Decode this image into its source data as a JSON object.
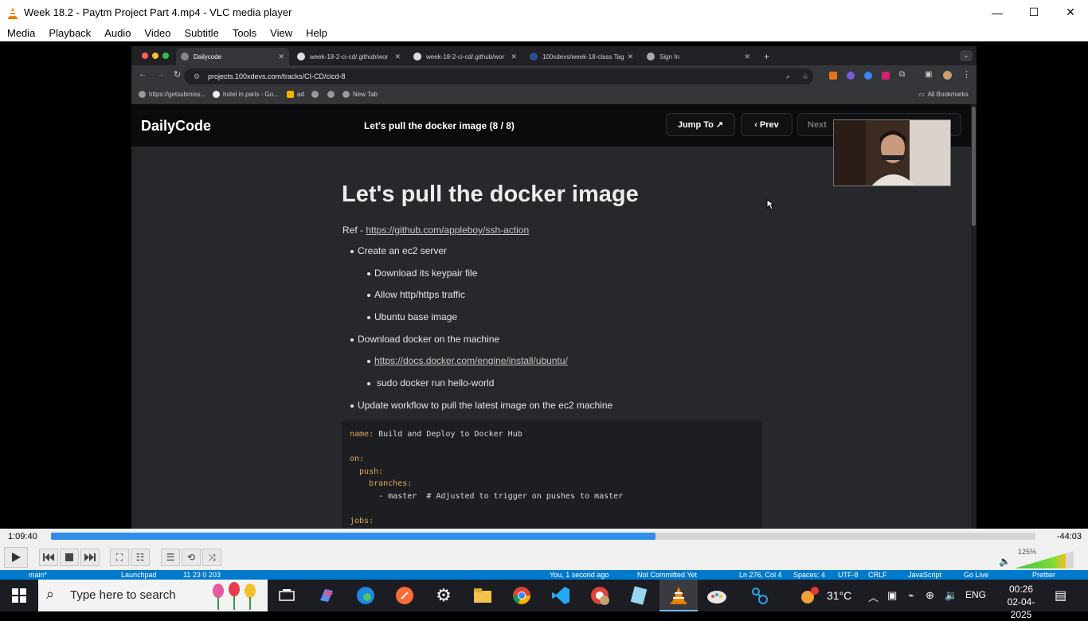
{
  "window": {
    "title": "Week 18.2 - Paytm Project Part 4.mp4 - VLC media player",
    "minimize": "—",
    "maximize": "☐",
    "close": "✕"
  },
  "menu": [
    "Media",
    "Playback",
    "Audio",
    "Video",
    "Subtitle",
    "Tools",
    "View",
    "Help"
  ],
  "browser": {
    "tabs": [
      {
        "label": "Dailycode"
      },
      {
        "label": "week-18-2-ci-cd/.github/wor"
      },
      {
        "label": "week-18-2-ci-cd/.github/wor"
      },
      {
        "label": "100xdevs/week-18-class Tag"
      },
      {
        "label": "Sign In"
      }
    ],
    "new_tab": "+",
    "url": "projects.100xdevs.com/tracks/CI-CD/cicd-8",
    "bookmarks": [
      "https://getsubmiss...",
      "hotel in paris - Go...",
      "ad",
      "",
      "",
      "New Tab"
    ],
    "all_bookmarks": "All Bookmarks"
  },
  "site": {
    "logo": "DailyCode",
    "page_title": "Let's pull the docker image (8 / 8)",
    "jump_to": "Jump To ↗",
    "prev": "‹  Prev",
    "next": "Next"
  },
  "article": {
    "heading": "Let's pull the docker image",
    "ref_label": "Ref - ",
    "ref_link": "https://github.com/appleboy/ssh-action",
    "items": [
      "Create an ec2 server",
      "Download its keypair file",
      "Allow http/https traffic",
      "Ubuntu base image",
      "Download docker on the machine",
      "https://docs.docker.com/engine/install/ubuntu/",
      "sudo docker run hello-world",
      "Update workflow to pull the latest image on the ec2 machine"
    ],
    "code": [
      {
        "key": "name:",
        "rest": " Build and Deploy to Docker Hub"
      },
      {
        "key": "",
        "rest": ""
      },
      {
        "key": "on:",
        "rest": ""
      },
      {
        "key": "  push:",
        "rest": ""
      },
      {
        "key": "    branches:",
        "rest": ""
      },
      {
        "key": "",
        "rest": "      - master  # Adjusted to trigger on pushes to master"
      },
      {
        "key": "",
        "rest": ""
      },
      {
        "key": "jobs:",
        "rest": ""
      }
    ]
  },
  "player": {
    "elapsed": "1:09:40",
    "remaining": "-44:03",
    "progress": 0.614,
    "volume": "125%"
  },
  "vscode_status": [
    "main*",
    "Launchpad",
    "11 23 0 203",
    "You, 1 second ago",
    "Not Committed Yet",
    "Ln 276, Col 4",
    "Spaces: 4",
    "UTF-8",
    "CRLF",
    "JavaScript",
    "Go Live",
    "Prettier"
  ],
  "taskbar": {
    "search_placeholder": "Type here to search",
    "temperature": "31°C",
    "language": "ENG",
    "time": "00:26",
    "date": "02-04-2025"
  },
  "colors": {
    "vlc_orange": "#f28a00",
    "seek_blue": "#2f8ee8",
    "vscode_blue": "#007acc",
    "page_bg": "#27282b"
  }
}
